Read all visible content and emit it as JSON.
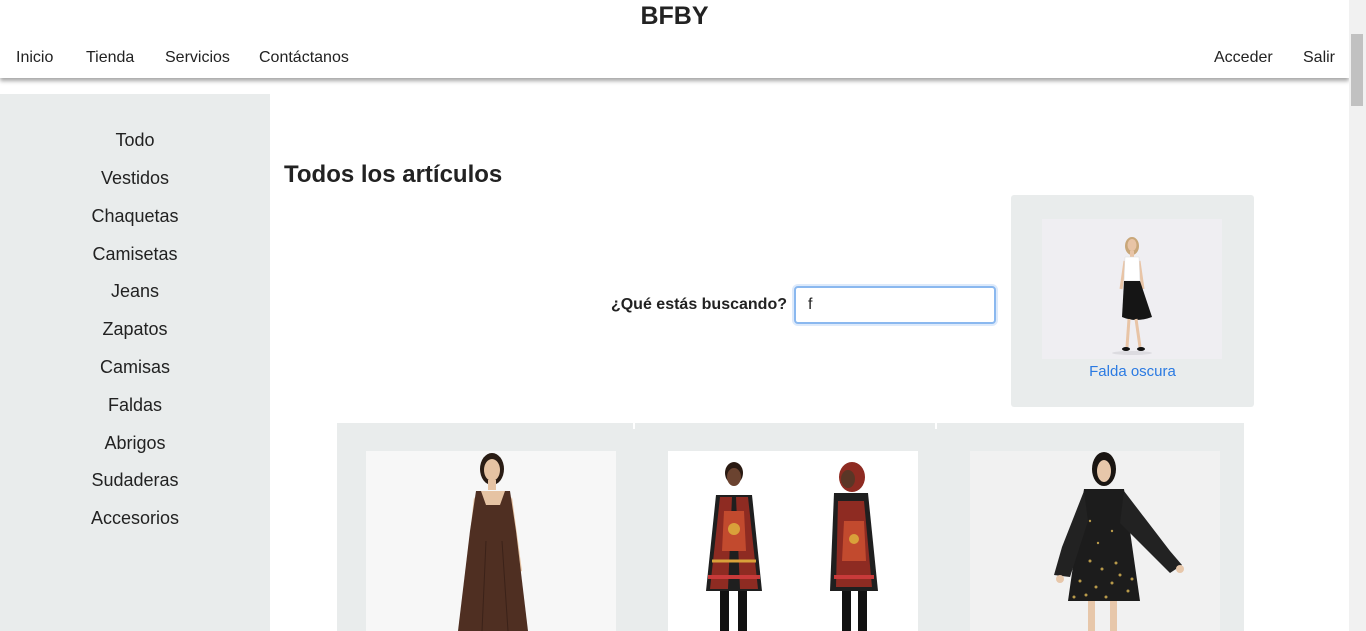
{
  "header": {
    "brand": "BFBY",
    "nav_left": [
      "Inicio",
      "Tienda",
      "Servicios",
      "Contáctanos"
    ],
    "nav_right": [
      "Acceder",
      "Salir"
    ]
  },
  "sidebar": {
    "categories": [
      "Todo",
      "Vestidos",
      "Chaquetas",
      "Camisetas",
      "Jeans",
      "Zapatos",
      "Camisas",
      "Faldas",
      "Abrigos",
      "Sudaderas",
      "Accesorios"
    ]
  },
  "main": {
    "title": "Todos los artículos",
    "search": {
      "label": "¿Qué estás buscando?",
      "value": "f"
    },
    "suggestion": {
      "label": "Falda oscura",
      "image": "woman-white-top-black-skirt-photo"
    },
    "products": [
      {
        "image": "brown-maxi-dress-photo"
      },
      {
        "image": "printed-hooded-jacket-photo"
      },
      {
        "image": "black-floral-dress-photo"
      }
    ]
  },
  "colors": {
    "sidebar_bg": "#e9ecec",
    "link": "#2a7ae2",
    "input_focus": "#8ab8ef"
  }
}
